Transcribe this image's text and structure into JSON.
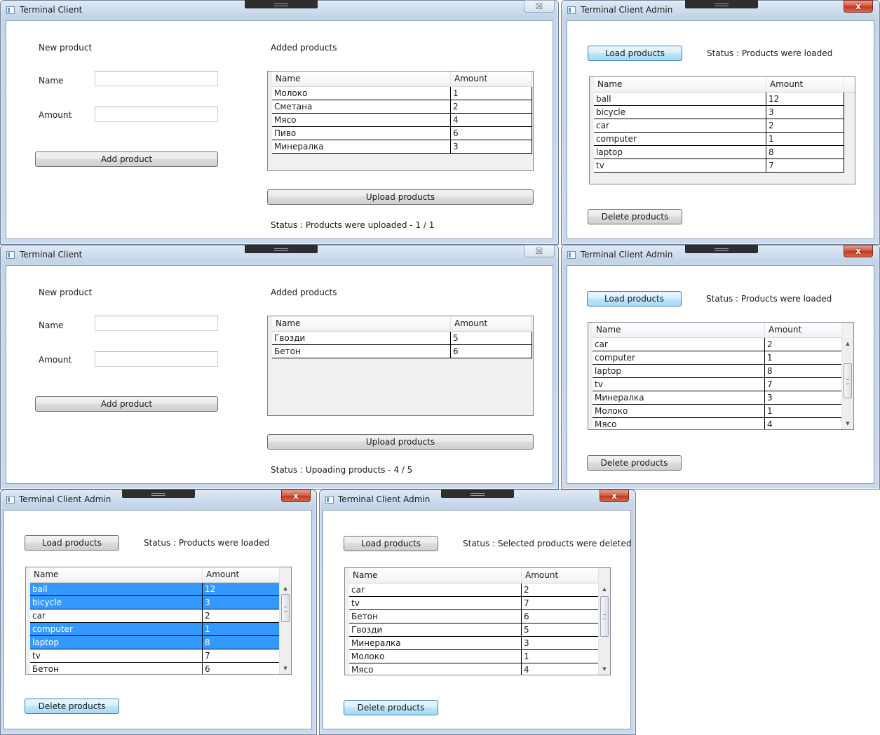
{
  "windows": {
    "client1": {
      "title": "Terminal Client",
      "close_glyph": "☒",
      "new_product_label": "New product",
      "name_label": "Name",
      "amount_label": "Amount",
      "name_value": "",
      "amount_value": "",
      "add_button": "Add product",
      "added_label": "Added products",
      "columns": [
        "Name",
        "Amount"
      ],
      "rows": [
        {
          "name": "Молоко",
          "amount": "1"
        },
        {
          "name": "Сметана",
          "amount": "2"
        },
        {
          "name": "Мясо",
          "amount": "4"
        },
        {
          "name": "Пиво",
          "amount": "6"
        },
        {
          "name": "Минералка",
          "amount": "3"
        }
      ],
      "upload_button": "Upload products",
      "status": "Status : Products were uploaded - 1 / 1"
    },
    "admin1": {
      "title": "Terminal Client Admin",
      "close_glyph": "x",
      "load_button": "Load products",
      "status": "Status : Products were loaded",
      "columns": [
        "Name",
        "Amount"
      ],
      "rows": [
        {
          "name": "ball",
          "amount": "12"
        },
        {
          "name": "bicycle",
          "amount": "3"
        },
        {
          "name": "car",
          "amount": "2"
        },
        {
          "name": "computer",
          "amount": "1"
        },
        {
          "name": "laptop",
          "amount": "8"
        },
        {
          "name": "tv",
          "amount": "7"
        }
      ],
      "delete_button": "Delete products"
    },
    "client2": {
      "title": "Terminal Client",
      "close_glyph": "☒",
      "new_product_label": "New product",
      "name_label": "Name",
      "amount_label": "Amount",
      "name_value": "",
      "amount_value": "",
      "add_button": "Add product",
      "added_label": "Added products",
      "columns": [
        "Name",
        "Amount"
      ],
      "rows": [
        {
          "name": "Гвозди",
          "amount": "5"
        },
        {
          "name": "Бетон",
          "amount": "6"
        }
      ],
      "upload_button": "Upload products",
      "status": "Status : Upoading products - 4 / 5"
    },
    "admin2": {
      "title": "Terminal Client Admin",
      "close_glyph": "x",
      "load_button": "Load products",
      "status": "Status : Products were loaded",
      "columns": [
        "Name",
        "Amount"
      ],
      "rows": [
        {
          "name": "car",
          "amount": "2"
        },
        {
          "name": "computer",
          "amount": "1"
        },
        {
          "name": "laptop",
          "amount": "8"
        },
        {
          "name": "tv",
          "amount": "7"
        },
        {
          "name": "Минералка",
          "amount": "3"
        },
        {
          "name": "Молоко",
          "amount": "1"
        },
        {
          "name": "Мясо",
          "amount": "4"
        }
      ],
      "delete_button": "Delete products"
    },
    "admin3": {
      "title": "Terminal Client Admin",
      "close_glyph": "x",
      "load_button": "Load products",
      "status": "Status : Products were loaded",
      "columns": [
        "Name",
        "Amount"
      ],
      "rows": [
        {
          "name": "ball",
          "amount": "12",
          "selected": true
        },
        {
          "name": "bicycle",
          "amount": "3",
          "selected": true
        },
        {
          "name": "car",
          "amount": "2",
          "selected": false
        },
        {
          "name": "computer",
          "amount": "1",
          "selected": true
        },
        {
          "name": "laptop",
          "amount": "8",
          "selected": true
        },
        {
          "name": "tv",
          "amount": "7",
          "selected": false
        },
        {
          "name": "Бетон",
          "amount": "6",
          "selected": false
        }
      ],
      "delete_button": "Delete products"
    },
    "admin4": {
      "title": "Terminal Client Admin",
      "close_glyph": "x",
      "load_button": "Load products",
      "status": "Status : Selected products were deleted",
      "columns": [
        "Name",
        "Amount"
      ],
      "rows": [
        {
          "name": "car",
          "amount": "2"
        },
        {
          "name": "tv",
          "amount": "7"
        },
        {
          "name": "Бетон",
          "amount": "6"
        },
        {
          "name": "Гвозди",
          "amount": "5"
        },
        {
          "name": "Минералка",
          "amount": "3"
        },
        {
          "name": "Молоко",
          "amount": "1"
        },
        {
          "name": "Мясо",
          "amount": "4"
        }
      ],
      "delete_button": "Delete products"
    }
  },
  "colors": {
    "selection": "#3399ff",
    "close_button": "#c2391f",
    "window_frame": "#c4d5ea"
  }
}
